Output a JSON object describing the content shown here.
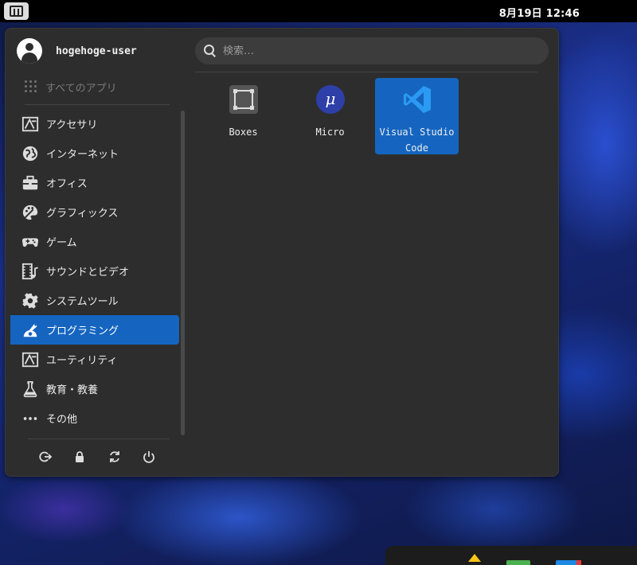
{
  "topbar": {
    "logo_icon": "manjaro-logo-icon",
    "clock": "8月19日  12:46"
  },
  "menu": {
    "user": {
      "name": "hogehoge-user",
      "icon": "user-avatar-icon"
    },
    "search": {
      "placeholder": "検索…",
      "icon": "search-icon"
    },
    "all_apps_label": "すべてのアプリ",
    "categories": [
      {
        "label": "アクセサリ",
        "icon": "accessories-icon",
        "active": false
      },
      {
        "label": "インターネット",
        "icon": "globe-icon",
        "active": false
      },
      {
        "label": "オフィス",
        "icon": "briefcase-icon",
        "active": false
      },
      {
        "label": "グラフィックス",
        "icon": "palette-icon",
        "active": false
      },
      {
        "label": "ゲーム",
        "icon": "gamepad-icon",
        "active": false
      },
      {
        "label": "サウンドとビデオ",
        "icon": "multimedia-icon",
        "active": false
      },
      {
        "label": "システムツール",
        "icon": "gear-icon",
        "active": false
      },
      {
        "label": "プログラミング",
        "icon": "development-icon",
        "active": true
      },
      {
        "label": "ユーティリティ",
        "icon": "utilities-icon",
        "active": false
      },
      {
        "label": "教育・教養",
        "icon": "flask-icon",
        "active": false
      },
      {
        "label": "その他",
        "icon": "more-dots-icon",
        "active": false
      }
    ],
    "actions": [
      {
        "name": "logout",
        "icon": "logout-icon"
      },
      {
        "name": "lock",
        "icon": "lock-icon"
      },
      {
        "name": "restart",
        "icon": "restart-icon"
      },
      {
        "name": "power",
        "icon": "power-icon"
      }
    ],
    "apps": [
      {
        "line1": "Boxes",
        "line2": "",
        "icon": "boxes-icon",
        "selected": false
      },
      {
        "line1": "Micro",
        "line2": "",
        "icon": "micro-icon",
        "selected": false
      },
      {
        "line1": "Visual Studio",
        "line2": "Code",
        "icon": "vscode-icon",
        "selected": true
      }
    ]
  },
  "colors": {
    "accent": "#1565c0",
    "panel": "#2d2d2d",
    "topbar": "#000000"
  }
}
